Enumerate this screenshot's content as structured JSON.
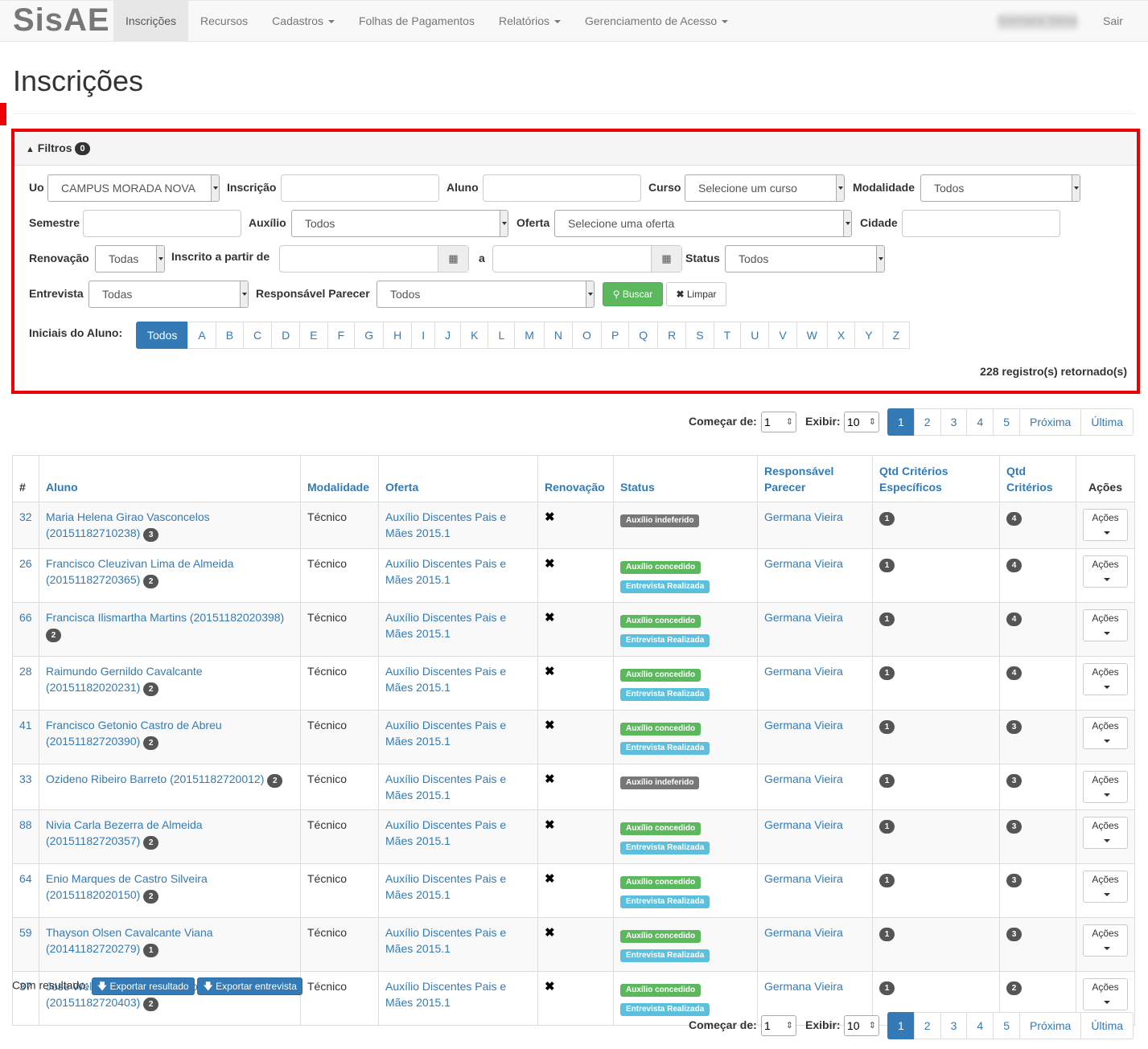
{
  "nav": {
    "brand": "SisAE",
    "items": [
      "Inscrições",
      "Recursos",
      "Cadastros",
      "Folhas de Pagamentos",
      "Relatórios",
      "Gerenciamento de Acesso"
    ],
    "user": "Germana Vieira",
    "logout": "Sair"
  },
  "page": {
    "title": "Inscrições"
  },
  "filters": {
    "title": "Filtros",
    "count": "0",
    "uo_label": "Uo",
    "uo_value": "CAMPUS MORADA NOVA",
    "inscricao_label": "Inscrição",
    "aluno_label": "Aluno",
    "curso_label": "Curso",
    "curso_value": "Selecione um curso",
    "modalidade_label": "Modalidade",
    "modalidade_value": "Todos",
    "semestre_label": "Semestre",
    "auxilio_label": "Auxílio",
    "auxilio_value": "Todos",
    "oferta_label": "Oferta",
    "oferta_value": "Selecione uma oferta",
    "cidade_label": "Cidade",
    "renovacao_label": "Renovação",
    "renovacao_value": "Todas",
    "inscrito_label": "Inscrito a partir de",
    "a_label": "a",
    "status_label": "Status",
    "status_value": "Todos",
    "entrevista_label": "Entrevista",
    "entrevista_value": "Todas",
    "parecer_label": "Responsável Parecer",
    "parecer_value": "Todos",
    "buscar": "Buscar",
    "limpar": "Limpar",
    "iniciais_label": "Iniciais do Aluno:",
    "letters": [
      "Todos",
      "A",
      "B",
      "C",
      "D",
      "E",
      "F",
      "G",
      "H",
      "I",
      "J",
      "K",
      "L",
      "M",
      "N",
      "O",
      "P",
      "Q",
      "R",
      "S",
      "T",
      "U",
      "V",
      "W",
      "X",
      "Y",
      "Z"
    ],
    "registros": "228 registro(s) retornado(s)"
  },
  "pagination": {
    "comecar_label": "Começar de:",
    "comecar_value": "1",
    "exibir_label": "Exibir:",
    "exibir_value": "10",
    "pages": [
      "1",
      "2",
      "3",
      "4",
      "5",
      "Próxima",
      "Última"
    ]
  },
  "table": {
    "headers": [
      "#",
      "Aluno",
      "Modalidade",
      "Oferta",
      "Renovação",
      "Status",
      "Responsável Parecer",
      "Qtd Critérios Específicos",
      "Qtd Critérios",
      "Ações"
    ],
    "rows": [
      {
        "id": "32",
        "aluno": "Maria Helena Girao Vasconcelos (20151182710238)",
        "count": "3",
        "modalidade": "Técnico",
        "oferta": "Auxílio Discentes Pais e Mães 2015.1",
        "status": [
          "Auxílio indeferido"
        ],
        "parecer": "Germana Vieira",
        "esp": "1",
        "crit": "4"
      },
      {
        "id": "26",
        "aluno": "Francisco Cleuzivan Lima de Almeida (20151182720365)",
        "count": "2",
        "modalidade": "Técnico",
        "oferta": "Auxílio Discentes Pais e Mães 2015.1",
        "status": [
          "Auxílio concedido",
          "Entrevista Realizada"
        ],
        "parecer": "Germana Vieira",
        "esp": "1",
        "crit": "4"
      },
      {
        "id": "66",
        "aluno": "Francisca Ilismartha Martins (20151182020398)",
        "count": "2",
        "modalidade": "Técnico",
        "oferta": "Auxílio Discentes Pais e Mães 2015.1",
        "status": [
          "Auxílio concedido",
          "Entrevista Realizada"
        ],
        "parecer": "Germana Vieira",
        "esp": "1",
        "crit": "4"
      },
      {
        "id": "28",
        "aluno": "Raimundo Gernildo Cavalcante (20151182020231)",
        "count": "2",
        "modalidade": "Técnico",
        "oferta": "Auxílio Discentes Pais e Mães 2015.1",
        "status": [
          "Auxílio concedido",
          "Entrevista Realizada"
        ],
        "parecer": "Germana Vieira",
        "esp": "1",
        "crit": "4"
      },
      {
        "id": "41",
        "aluno": "Francisco Getonio Castro de Abreu (20151182720390)",
        "count": "2",
        "modalidade": "Técnico",
        "oferta": "Auxílio Discentes Pais e Mães 2015.1",
        "status": [
          "Auxílio concedido",
          "Entrevista Realizada"
        ],
        "parecer": "Germana Vieira",
        "esp": "1",
        "crit": "3"
      },
      {
        "id": "33",
        "aluno": "Ozideno Ribeiro Barreto (20151182720012)",
        "count": "2",
        "modalidade": "Técnico",
        "oferta": "Auxílio Discentes Pais e Mães 2015.1",
        "status": [
          "Auxílio indeferido"
        ],
        "parecer": "Germana Vieira",
        "esp": "1",
        "crit": "3"
      },
      {
        "id": "88",
        "aluno": "Nivia Carla Bezerra de Almeida (20151182720357)",
        "count": "2",
        "modalidade": "Técnico",
        "oferta": "Auxílio Discentes Pais e Mães 2015.1",
        "status": [
          "Auxílio concedido",
          "Entrevista Realizada"
        ],
        "parecer": "Germana Vieira",
        "esp": "1",
        "crit": "3"
      },
      {
        "id": "64",
        "aluno": "Enio Marques de Castro Silveira (20151182020150)",
        "count": "2",
        "modalidade": "Técnico",
        "oferta": "Auxílio Discentes Pais e Mães 2015.1",
        "status": [
          "Auxílio concedido",
          "Entrevista Realizada"
        ],
        "parecer": "Germana Vieira",
        "esp": "1",
        "crit": "3"
      },
      {
        "id": "59",
        "aluno": "Thayson Olsen Cavalcante Viana (20141182720279)",
        "count": "1",
        "modalidade": "Técnico",
        "oferta": "Auxílio Discentes Pais e Mães 2015.1",
        "status": [
          "Auxílio concedido",
          "Entrevista Realizada"
        ],
        "parecer": "Germana Vieira",
        "esp": "1",
        "crit": "3"
      },
      {
        "id": "37",
        "aluno": "Jose Wellington de Oliveira dos Santos (20151182720403)",
        "count": "2",
        "modalidade": "Técnico",
        "oferta": "Auxílio Discentes Pais e Mães 2015.1",
        "status": [
          "Auxílio concedido",
          "Entrevista Realizada"
        ],
        "parecer": "Germana Vieira",
        "esp": "1",
        "crit": "2"
      }
    ],
    "acoes_label": "Ações"
  },
  "export": {
    "label": "Com resultado:",
    "resultado": "Exportar resultado",
    "entrevista": "Exportar entrevista"
  }
}
